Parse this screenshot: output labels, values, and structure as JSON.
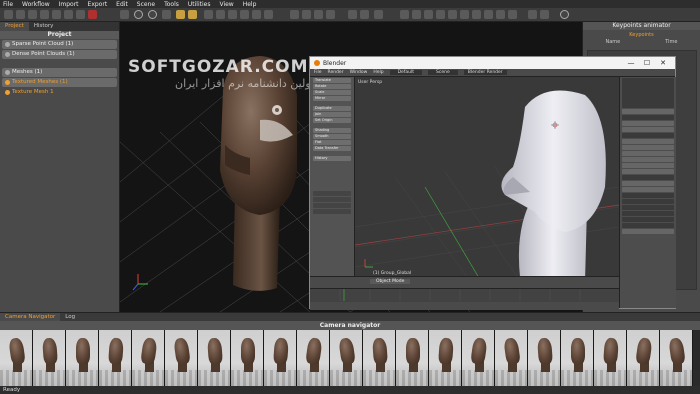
{
  "menu": [
    "File",
    "Workflow",
    "Import",
    "Export",
    "Edit",
    "Scene",
    "Tools",
    "Utilities",
    "View",
    "Help"
  ],
  "left_panel": {
    "tabs": [
      "Project",
      "History"
    ],
    "header": "Project",
    "rows": [
      "Sparse Point Cloud (1)",
      "Dense Point Clouds (1)",
      "Meshes (1)",
      "Textured Meshes (1)"
    ],
    "item": "Texture Mesh 1"
  },
  "watermark": {
    "line1": "SOFTGOZAR.COM",
    "line2": "اولین دانشنامه نرم افزار ایران"
  },
  "right_panel": {
    "title": "Keypoints animator",
    "subtitle": "Keypoints",
    "columns": [
      "Name",
      "Time"
    ]
  },
  "blender": {
    "title": "Blender",
    "window_buttons": [
      "—",
      "☐",
      "✕"
    ],
    "infobar": [
      "File",
      "Render",
      "Window",
      "Help",
      "Default",
      "Scene",
      "Blender Render"
    ],
    "view_label": "User Persp",
    "object_label": "(1) Group_Global",
    "mode": "Object Mode",
    "toolshelf": [
      "Translate",
      "Rotate",
      "Scale",
      "Mirror",
      "Duplicate",
      "Join",
      "Set Origin",
      "Shading",
      "Smooth",
      "Flat",
      "Data Transfer",
      "History"
    ]
  },
  "bottom": {
    "tabs": [
      "Camera Navigator",
      "Log"
    ],
    "title": "Camera navigator",
    "thumb_count": 21
  },
  "status": "Ready",
  "colors": {
    "accent": "#f0a030",
    "background": "#3a3a3a"
  }
}
